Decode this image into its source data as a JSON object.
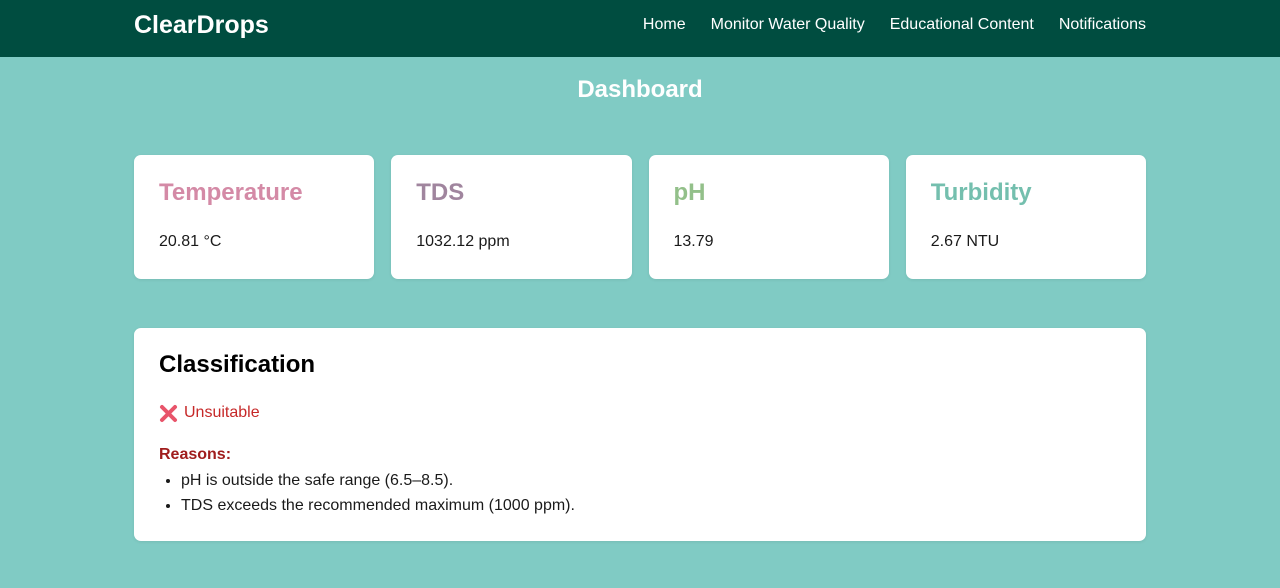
{
  "navbar": {
    "brand": "ClearDrops",
    "links": [
      "Home",
      "Monitor Water Quality",
      "Educational Content",
      "Notifications"
    ]
  },
  "page_title": "Dashboard",
  "cards": [
    {
      "title": "Temperature",
      "value": "20.81 °C",
      "color": "#d48aa6"
    },
    {
      "title": "TDS",
      "value": "1032.12 ppm",
      "color": "#a0859e"
    },
    {
      "title": "pH",
      "value": "13.79",
      "color": "#93c08a"
    },
    {
      "title": "Turbidity",
      "value": "2.67 NTU",
      "color": "#74bfae"
    }
  ],
  "classification": {
    "title": "Classification",
    "status_icon": "cross-mark-icon",
    "status": "Unsuitable",
    "reasons_label": "Reasons:",
    "reasons": [
      "pH is outside the safe range (6.5–8.5).",
      "TDS exceeds the recommended maximum (1000 ppm)."
    ]
  },
  "colors": {
    "navbar": "#004d40",
    "background": "#80cbc4",
    "status_red": "#c62828"
  }
}
